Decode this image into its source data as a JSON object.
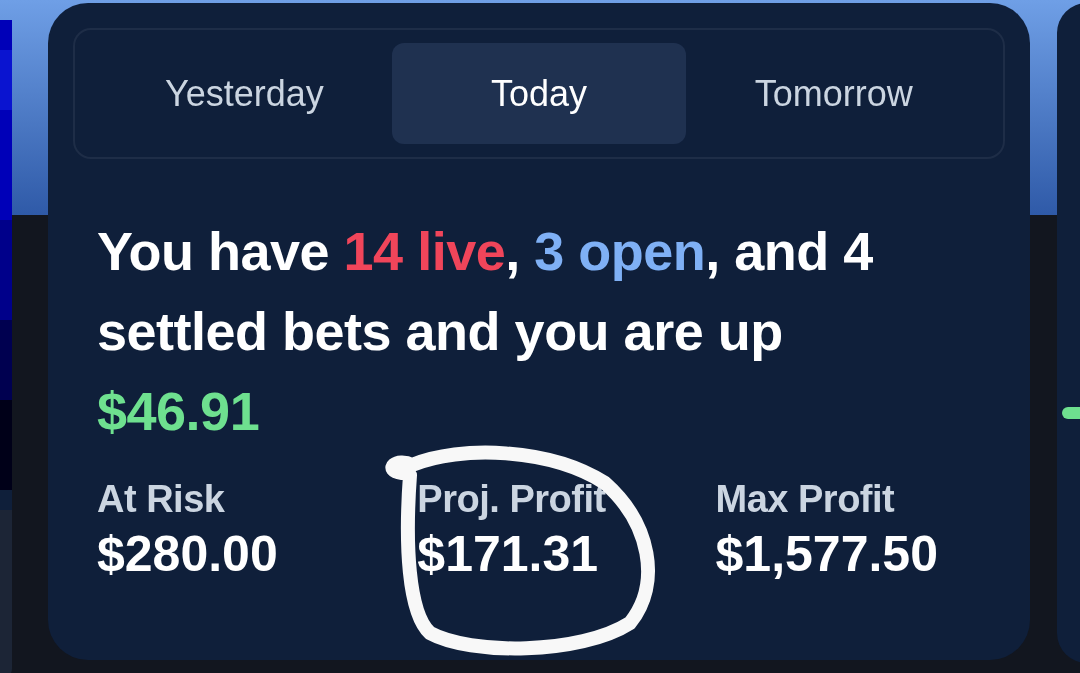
{
  "tabs": [
    {
      "label": "Yesterday",
      "selected": false
    },
    {
      "label": "Today",
      "selected": true
    },
    {
      "label": "Tomorrow",
      "selected": false
    }
  ],
  "summary": [
    {
      "text": "You have ",
      "color": "#ffffff"
    },
    {
      "text": "14 live",
      "color": "#f0455a"
    },
    {
      "text": ", ",
      "color": "#ffffff"
    },
    {
      "text": "3 open",
      "color": "#7fb0f5"
    },
    {
      "text": ", and 4 settled bets and you are up ",
      "color": "#ffffff"
    },
    {
      "text": "$46.91",
      "color": "#6ee08f"
    }
  ],
  "stats": [
    {
      "label": "At Risk",
      "value": "$280.00"
    },
    {
      "label": "Proj. Profit",
      "value": "$171.31"
    },
    {
      "label": "Max Profit",
      "value": "$1,577.50"
    }
  ]
}
